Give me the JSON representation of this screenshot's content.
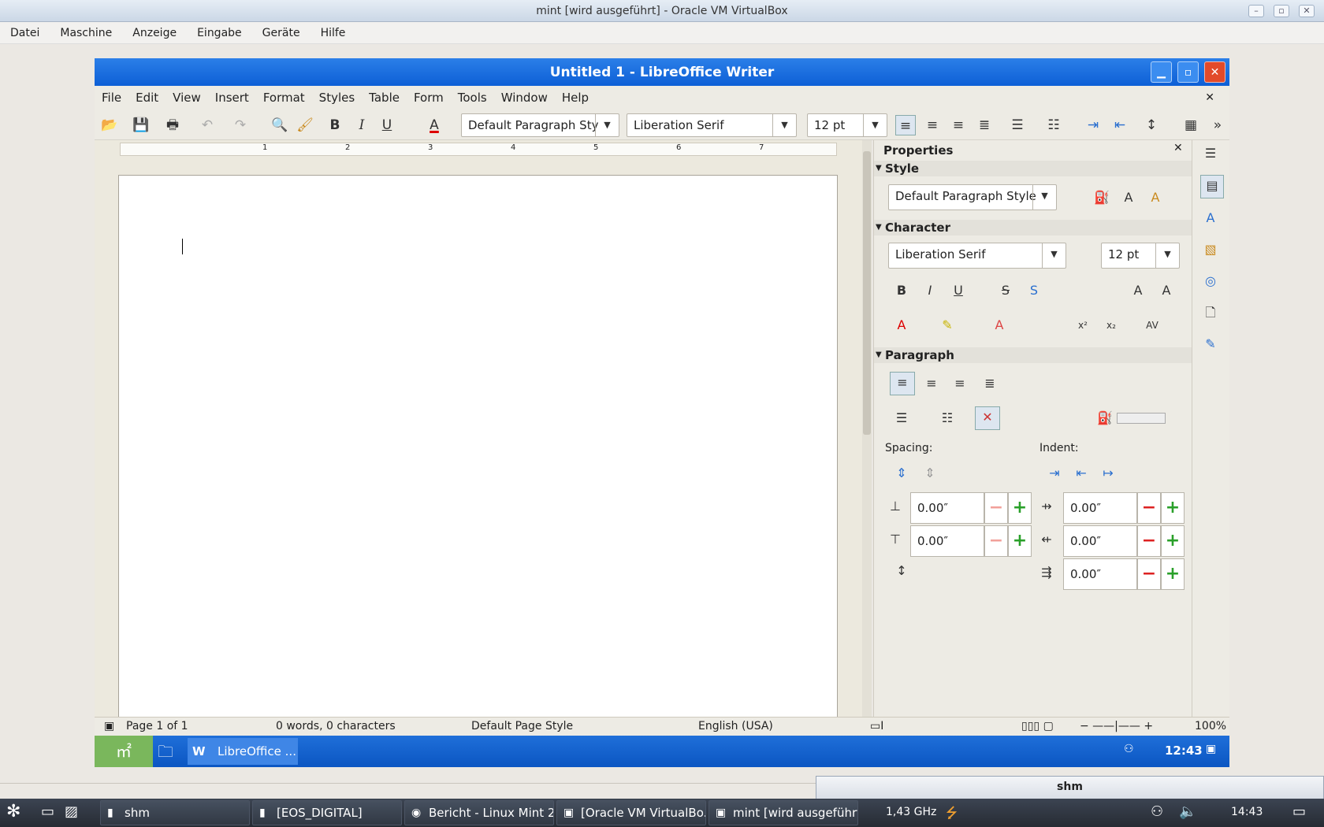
{
  "host_window": {
    "title": "mint [wird ausgeführt] - Oracle VM VirtualBox",
    "menu": [
      "Datei",
      "Maschine",
      "Anzeige",
      "Eingabe",
      "Geräte",
      "Hilfe"
    ]
  },
  "writer": {
    "title": "Untitled 1 - LibreOffice Writer",
    "menu": [
      "File",
      "Edit",
      "View",
      "Insert",
      "Format",
      "Styles",
      "Table",
      "Form",
      "Tools",
      "Window",
      "Help"
    ],
    "toolbar": {
      "paragraph_style": "Default Paragraph Sty",
      "font_name": "Liberation Serif",
      "font_size": "12 pt",
      "bold": "B",
      "italic": "I",
      "underline": "U",
      "font_color": "A"
    },
    "ruler_numbers": [
      "1",
      "2",
      "3",
      "4",
      "5",
      "6",
      "7"
    ],
    "sidebar": {
      "title": "Properties",
      "style_section": "Style",
      "style_value": "Default Paragraph Style",
      "character_section": "Character",
      "char_font": "Liberation Serif",
      "char_size": "12 pt",
      "paragraph_section": "Paragraph",
      "spacing_label": "Spacing:",
      "indent_label": "Indent:",
      "above_spacing": "0.00″",
      "below_spacing": "0.00″",
      "before_indent": "0.00″",
      "after_indent": "0.00″",
      "first_line_indent": "0.00″"
    },
    "status": {
      "page": "Page 1 of 1",
      "words": "0 words, 0 characters",
      "page_style": "Default Page Style",
      "language": "English (USA)",
      "zoom": "100%"
    }
  },
  "guest_taskbar": {
    "app_button": "LibreOffice ...",
    "clock": "12:43"
  },
  "host_taskbar": {
    "buttons": [
      "shm",
      "[EOS_DIGITAL]",
      "Bericht - Linux Mint 2...",
      "[Oracle VM VirtualBo...",
      "mint [wird ausgeführt..."
    ],
    "cpu": "1,43 GHz",
    "clock": "14:43",
    "shm_window_title": "shm"
  },
  "colors": {
    "guest_title": "#1266de",
    "close": "#e24a2a",
    "mint_green": "#7ab75c"
  }
}
